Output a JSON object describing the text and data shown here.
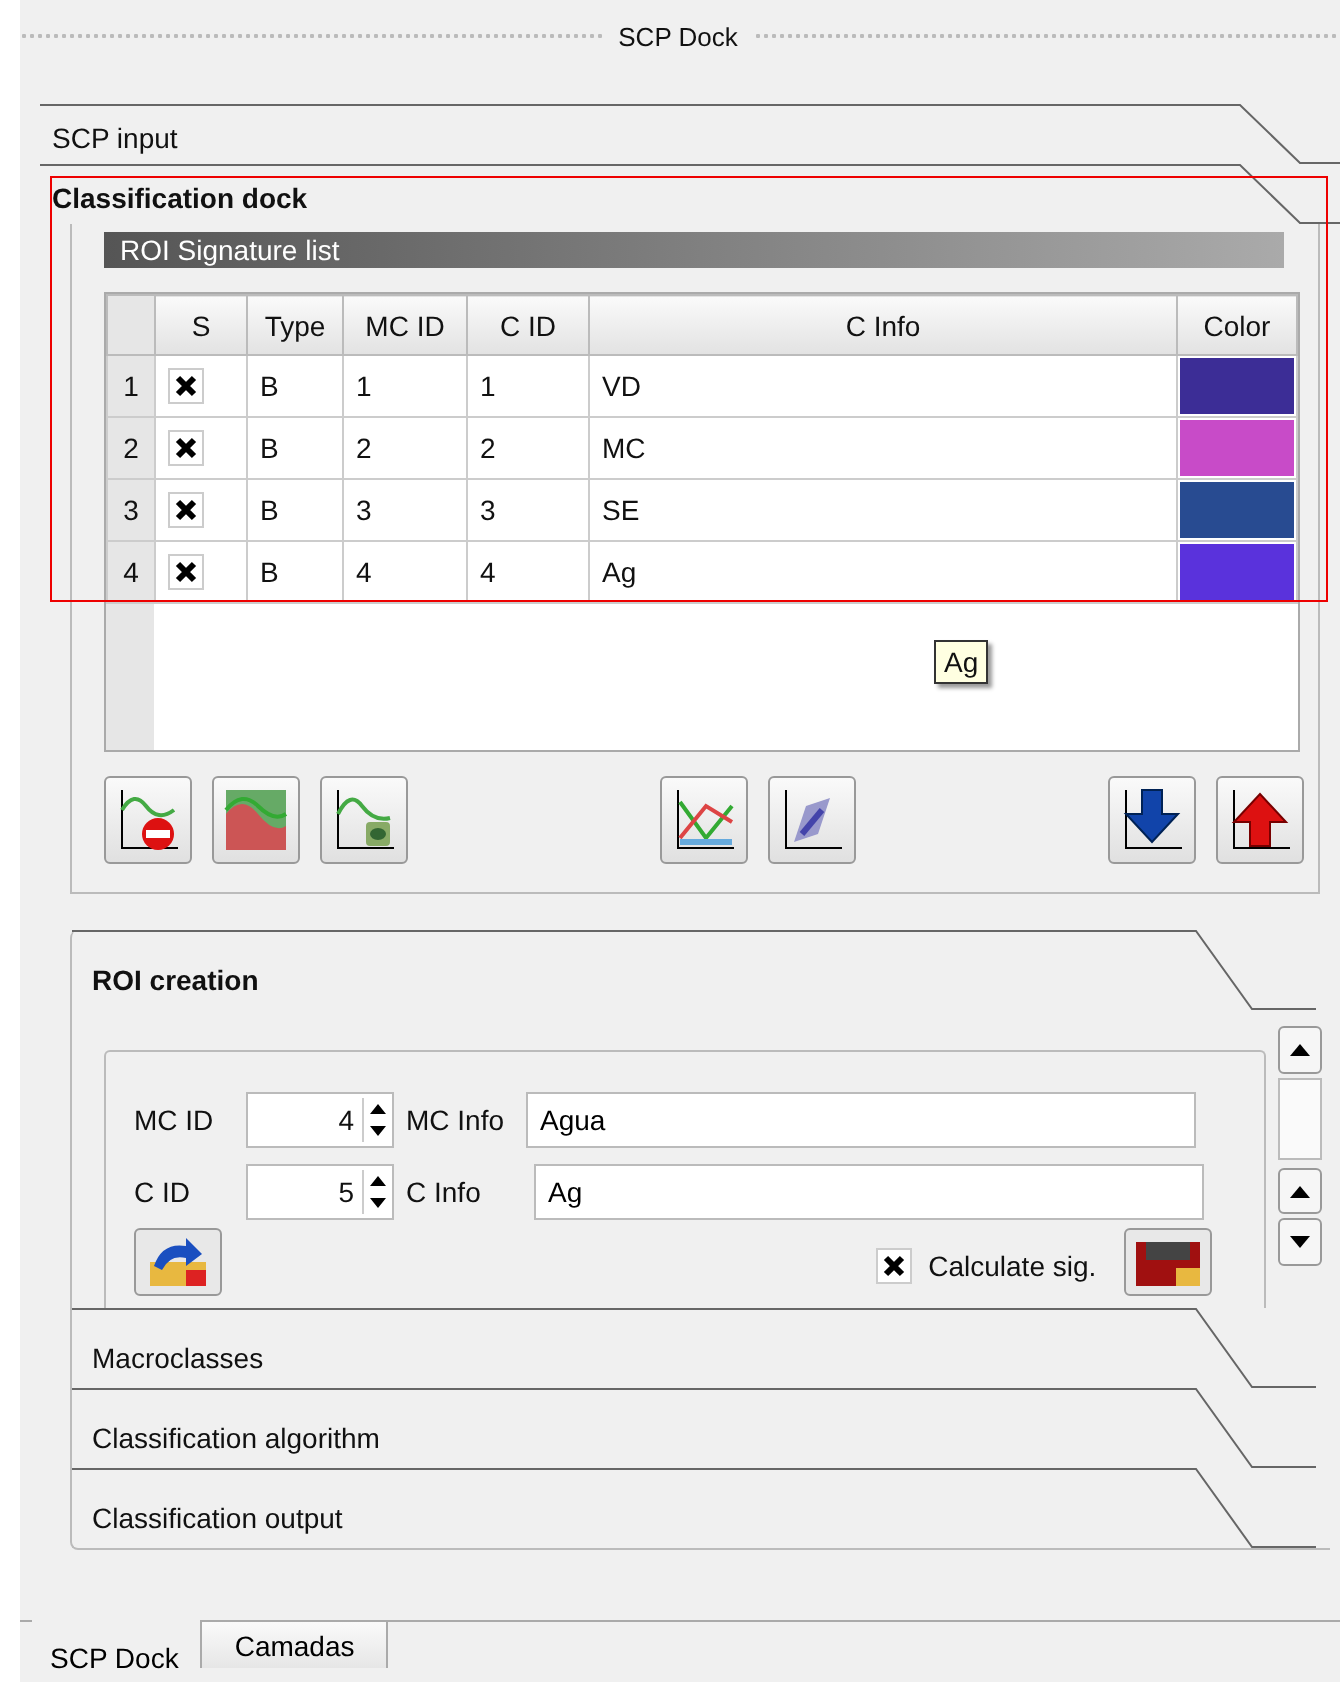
{
  "dock_title": "SCP Dock",
  "sections": [
    {
      "title": "SCP input",
      "expanded": false
    },
    {
      "title": "Classification dock",
      "expanded": true
    }
  ],
  "signature_list": {
    "title": "ROI Signature list",
    "columns": [
      "S",
      "Type",
      "MC ID",
      "C ID",
      "C Info",
      "Color"
    ],
    "rows": [
      {
        "number": "1",
        "checked": true,
        "type": "B",
        "mc_id": "1",
        "c_id": "1",
        "c_info": "VD",
        "color": "#3c2d96"
      },
      {
        "number": "2",
        "checked": true,
        "type": "B",
        "mc_id": "2",
        "c_id": "2",
        "c_info": "MC",
        "color": "#c84bc8"
      },
      {
        "number": "3",
        "checked": true,
        "type": "B",
        "mc_id": "3",
        "c_id": "3",
        "c_info": "SE",
        "color": "#284b91"
      },
      {
        "number": "4",
        "checked": true,
        "type": "B",
        "mc_id": "4",
        "c_id": "4",
        "c_info": "Ag",
        "color": "#5a32dc"
      }
    ],
    "tooltip": "Ag"
  },
  "inner_sections": [
    {
      "title": "ROI creation",
      "expanded": true
    },
    {
      "title": "Macroclasses",
      "expanded": false
    },
    {
      "title": "Classification algorithm",
      "expanded": false
    },
    {
      "title": "Classification output",
      "expanded": false
    }
  ],
  "roi_form": {
    "mc_id_label": "MC ID",
    "mc_id": "4",
    "mc_info_label": "MC Info",
    "mc_info": "Agua",
    "c_id_label": "C ID",
    "c_id": "5",
    "c_info_label": "C Info",
    "c_info": "Ag",
    "calculate": {
      "label": "Calculate sig.",
      "checked": true
    }
  },
  "bottom_tabs": [
    {
      "label": "SCP Dock",
      "selected": true
    },
    {
      "label": "Camadas",
      "selected": false
    }
  ]
}
